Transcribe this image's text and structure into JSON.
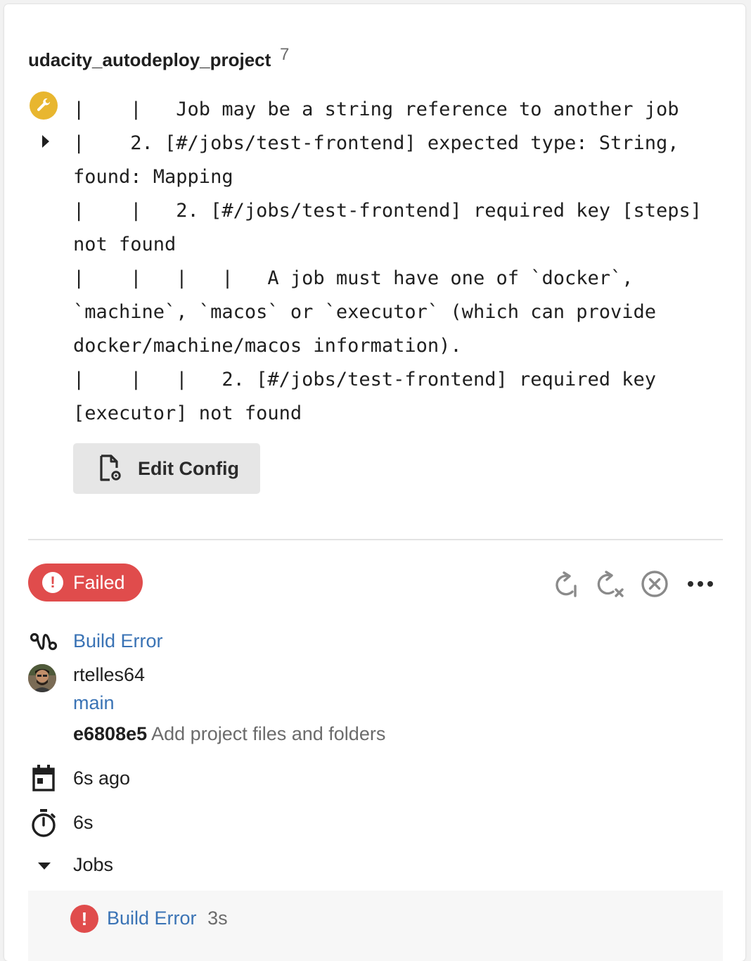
{
  "project": {
    "name": "udacity_autodeploy_project",
    "workflow_number": "7"
  },
  "config_error": {
    "text": "|    |   Job may be a string reference to another job\n|    2. [#/jobs/test-frontend] expected type: String, found: Mapping\n|    |   2. [#/jobs/test-frontend] required key [steps] not found\n|    |   |   |   A job must have one of `docker`, `machine`, `macos` or `executor` (which can provide docker/machine/macos information).\n|    |   |   2. [#/jobs/test-frontend] required key [executor] not found"
  },
  "edit_config": {
    "label": "Edit Config"
  },
  "pipeline": {
    "status": "Failed",
    "status_color": "#e04c4c",
    "actions": [
      "rerun-icon",
      "rerun-failed-icon",
      "cancel-icon",
      "more-icon"
    ],
    "workflow_label": "Build Error",
    "user": "rtelles64",
    "branch": "main",
    "commit_hash": "e6808e5",
    "commit_message": "Add project files and folders",
    "started": "6s ago",
    "duration": "6s",
    "jobs_label": "Jobs"
  },
  "jobs": [
    {
      "name": "Build Error",
      "duration": "3s",
      "status": "failed"
    }
  ],
  "colors": {
    "accent_link": "#3a73b5",
    "warning": "#e8b62f",
    "error": "#e04c4c"
  }
}
